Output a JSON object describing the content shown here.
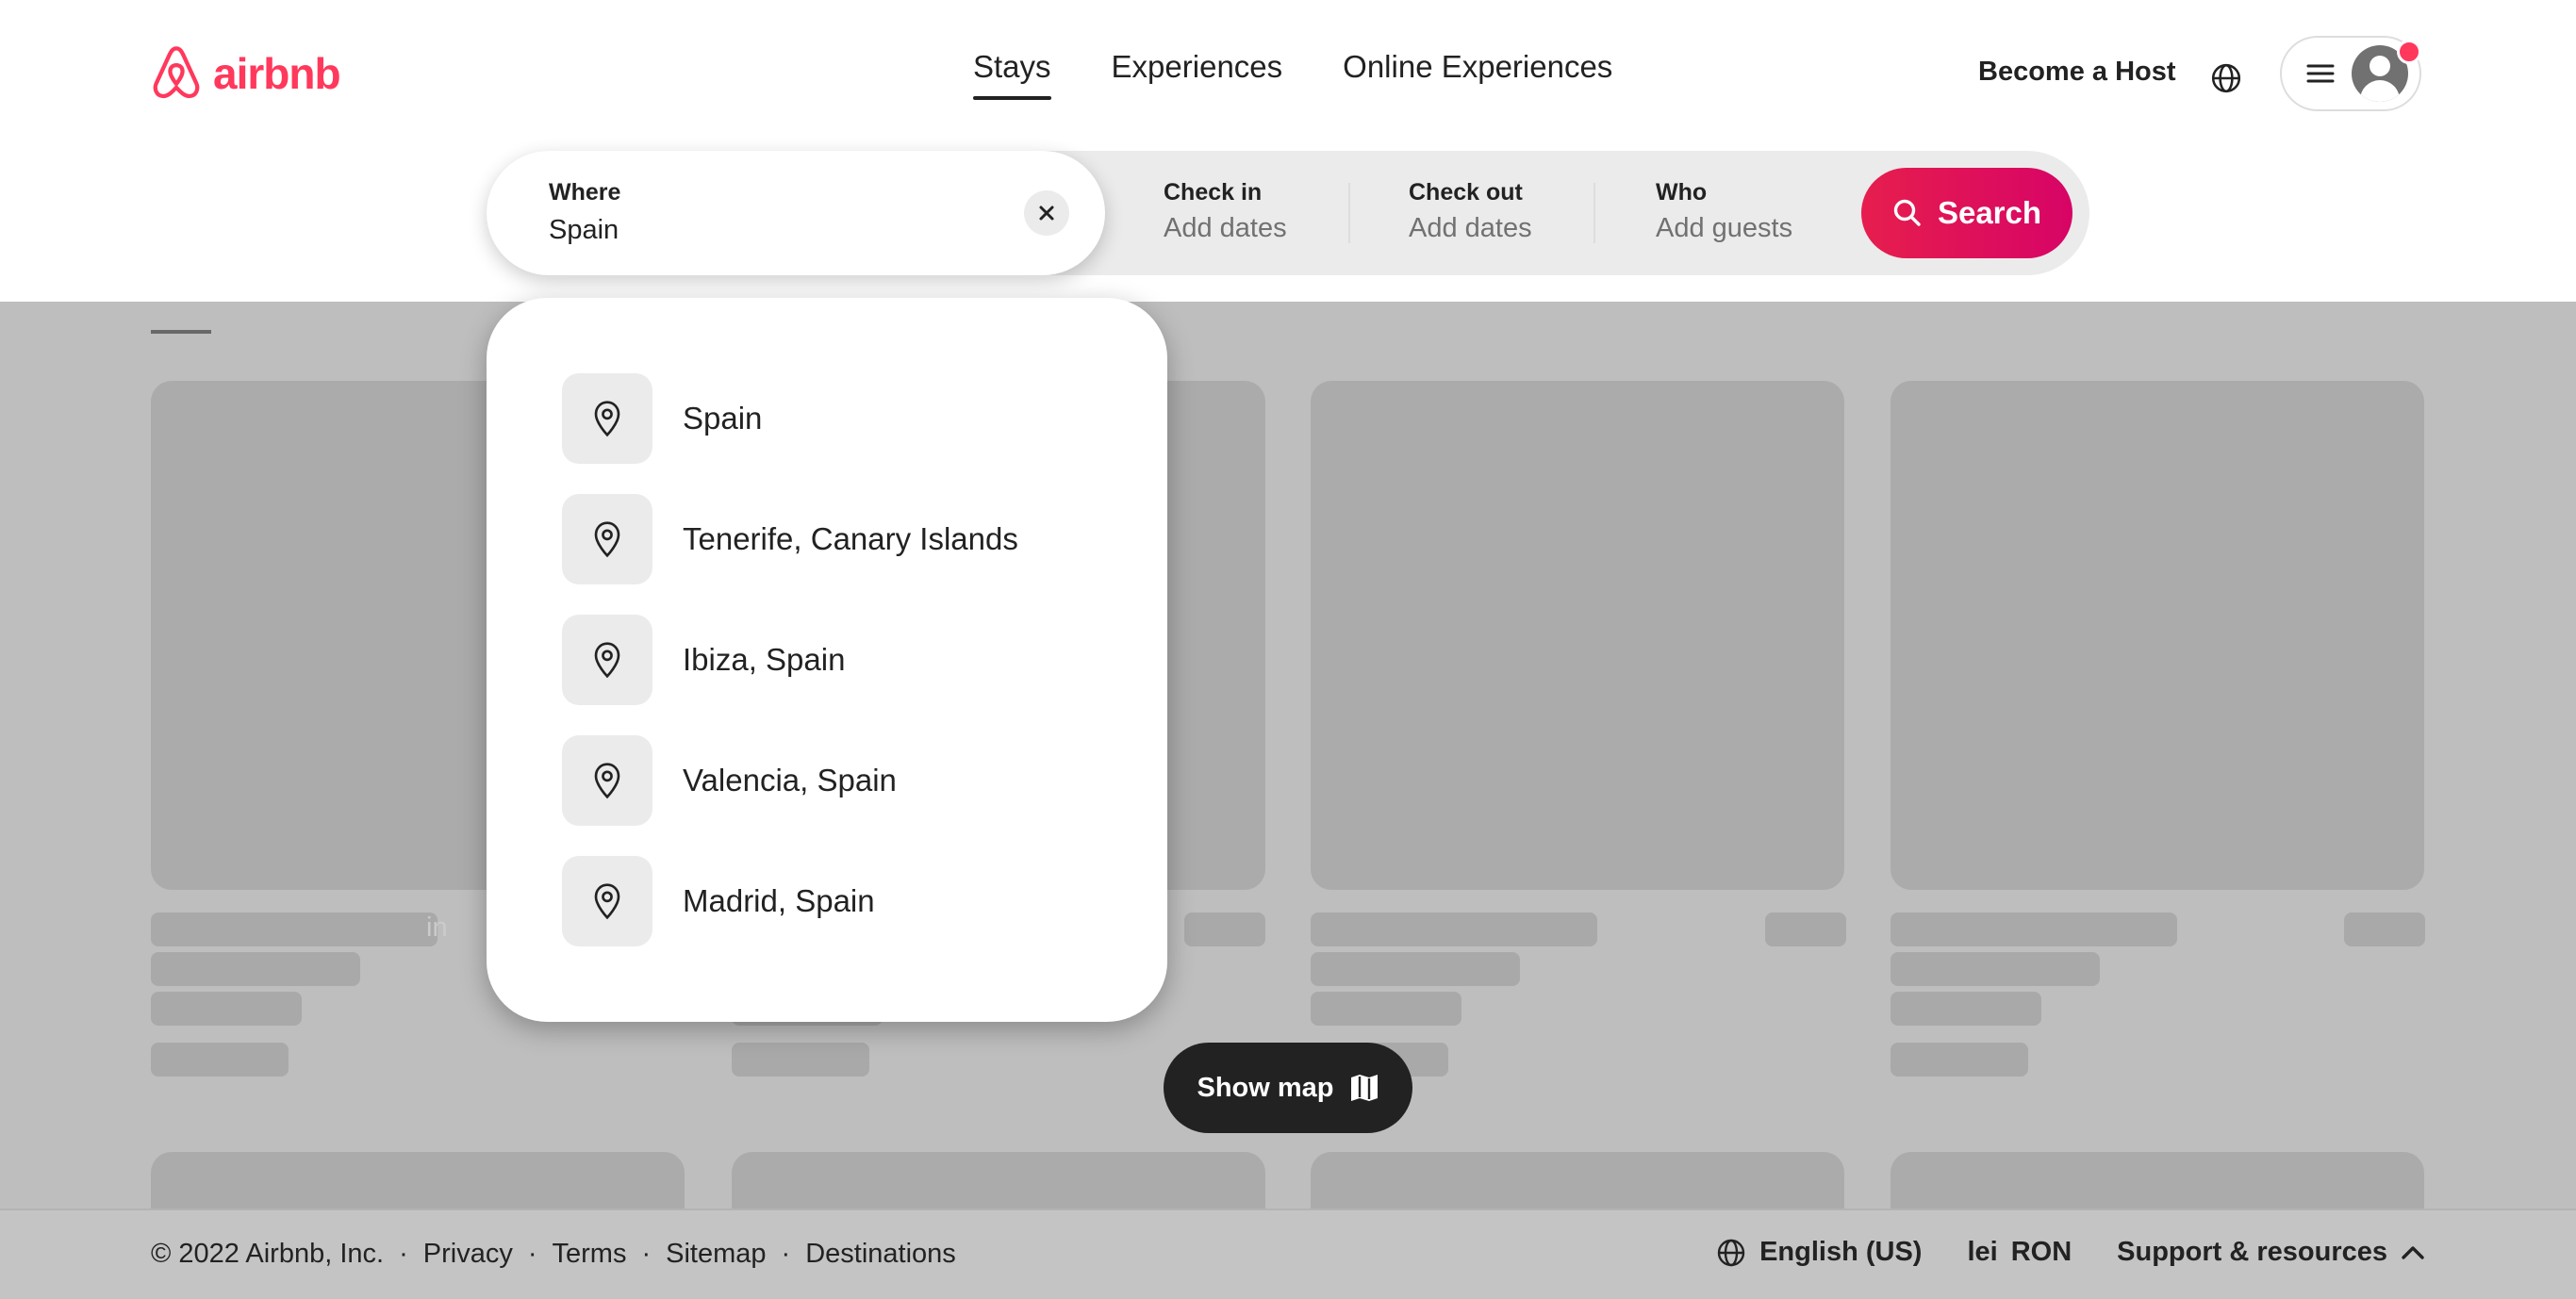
{
  "brand": {
    "name": "airbnb",
    "color": "#FF385C"
  },
  "header": {
    "nav": [
      {
        "label": "Stays",
        "active": true
      },
      {
        "label": "Experiences",
        "active": false
      },
      {
        "label": "Online Experiences",
        "active": false
      }
    ],
    "become_host": "Become a Host",
    "icons": {
      "language": "globe-icon",
      "menu": "hamburger-icon",
      "profile": "avatar-icon"
    },
    "notification_dot_color": "#FF385C"
  },
  "search": {
    "where": {
      "label": "Where",
      "value": "Spain"
    },
    "check_in": {
      "label": "Check in",
      "placeholder": "Add dates"
    },
    "check_out": {
      "label": "Check out",
      "placeholder": "Add dates"
    },
    "who": {
      "label": "Who",
      "placeholder": "Add guests"
    },
    "button_label": "Search",
    "button_color": "#E61E4D"
  },
  "suggestions": [
    {
      "label": "Spain",
      "icon": "map-pin-icon"
    },
    {
      "label": "Tenerife, Canary Islands",
      "icon": "map-pin-icon"
    },
    {
      "label": "Ibiza, Spain",
      "icon": "map-pin-icon"
    },
    {
      "label": "Valencia, Spain",
      "icon": "map-pin-icon"
    },
    {
      "label": "Madrid, Spain",
      "icon": "map-pin-icon"
    }
  ],
  "background": {
    "ghost_text": "in",
    "show_map_label": "Show map"
  },
  "footer": {
    "copyright": "© 2022 Airbnb, Inc.",
    "links": [
      "Privacy",
      "Terms",
      "Sitemap",
      "Destinations"
    ],
    "language": "English (US)",
    "currency_symbol": "lei",
    "currency": "RON",
    "support": "Support & resources"
  }
}
